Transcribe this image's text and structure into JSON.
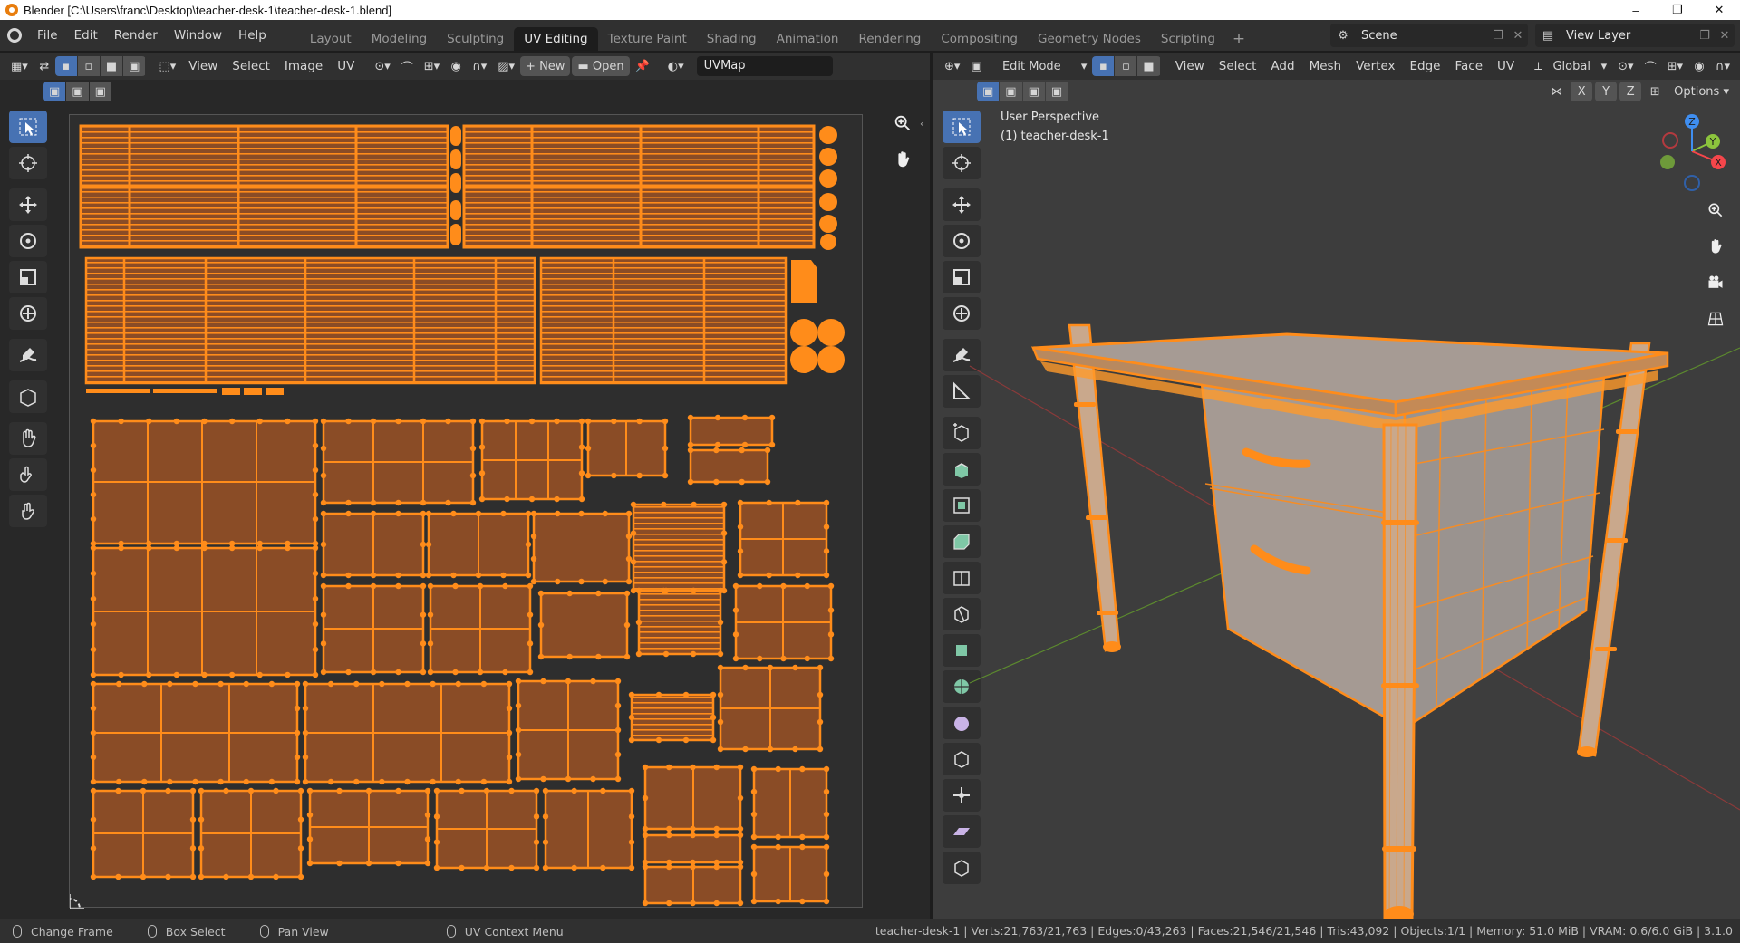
{
  "window": {
    "title": "Blender [C:\\Users\\franc\\Desktop\\teacher-desk-1\\teacher-desk-1.blend]",
    "controls": [
      "–",
      "❐",
      "✕"
    ]
  },
  "topbar": {
    "menus": [
      "File",
      "Edit",
      "Render",
      "Window",
      "Help"
    ],
    "workspaces": [
      "Layout",
      "Modeling",
      "Sculpting",
      "UV Editing",
      "Texture Paint",
      "Shading",
      "Animation",
      "Rendering",
      "Compositing",
      "Geometry Nodes",
      "Scripting"
    ],
    "active_workspace": "UV Editing",
    "add_label": "+",
    "scene": "Scene",
    "view_layer": "View Layer"
  },
  "uv_editor": {
    "menus": [
      "View",
      "Select",
      "Image",
      "UV"
    ],
    "new_label": "New",
    "open_label": "Open",
    "uvmap": "UVMap"
  },
  "view3d": {
    "mode": "Edit Mode",
    "menus": [
      "View",
      "Select",
      "Add",
      "Mesh",
      "Vertex",
      "Edge",
      "Face",
      "UV"
    ],
    "orientation": "Global",
    "axes": [
      "X",
      "Y",
      "Z"
    ],
    "options_label": "Options",
    "perspective": "User Perspective",
    "object_label": "(1) teacher-desk-1"
  },
  "statusbar": {
    "items": [
      "Change Frame",
      "Box Select",
      "Pan View",
      "UV Context Menu"
    ],
    "stats": "teacher-desk-1 | Verts:21,763/21,763 | Edges:0/43,263 | Faces:21,546/21,546 | Tris:43,092 | Objects:1/1 | Memory: 51.0 MiB | VRAM: 0.6/6.0 GiB | 3.1.0"
  },
  "colors": {
    "accent": "#4772b3",
    "selection": "#ff8c1a",
    "uv_face": "#8a4c26",
    "header": "#303030",
    "background": "#1d1d1d"
  }
}
